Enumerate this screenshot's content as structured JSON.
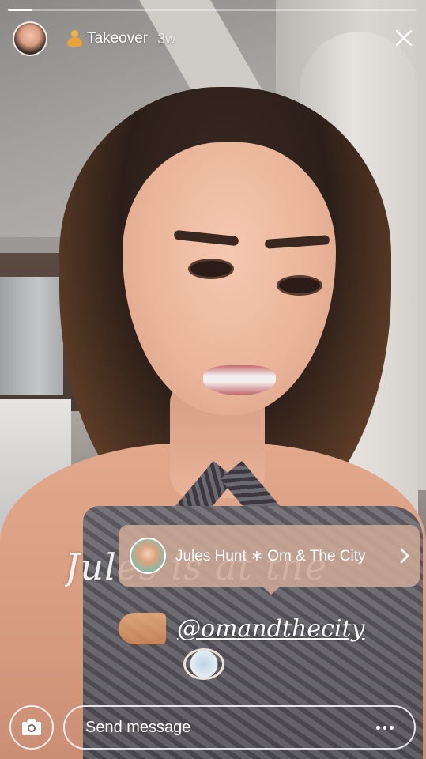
{
  "story": {
    "progress_fraction": 0.06
  },
  "header": {
    "title": "Takeover",
    "time_ago": "3w",
    "title_emoji": "person-meditating-emoji"
  },
  "close_icon": "close-icon",
  "sticker": {
    "script_text": "Jules is at the",
    "mention": "@omandthecity"
  },
  "tag_tooltip": {
    "label": "Jules Hunt ∗ Om & The City",
    "chevron_icon": "chevron-right-icon"
  },
  "bottom_bar": {
    "camera_icon": "camera-icon",
    "message_placeholder": "Send message",
    "more_icon": "more-horizontal-icon"
  },
  "colors": {
    "tooltip_bg": "#cda896",
    "text": "#ffffff"
  }
}
